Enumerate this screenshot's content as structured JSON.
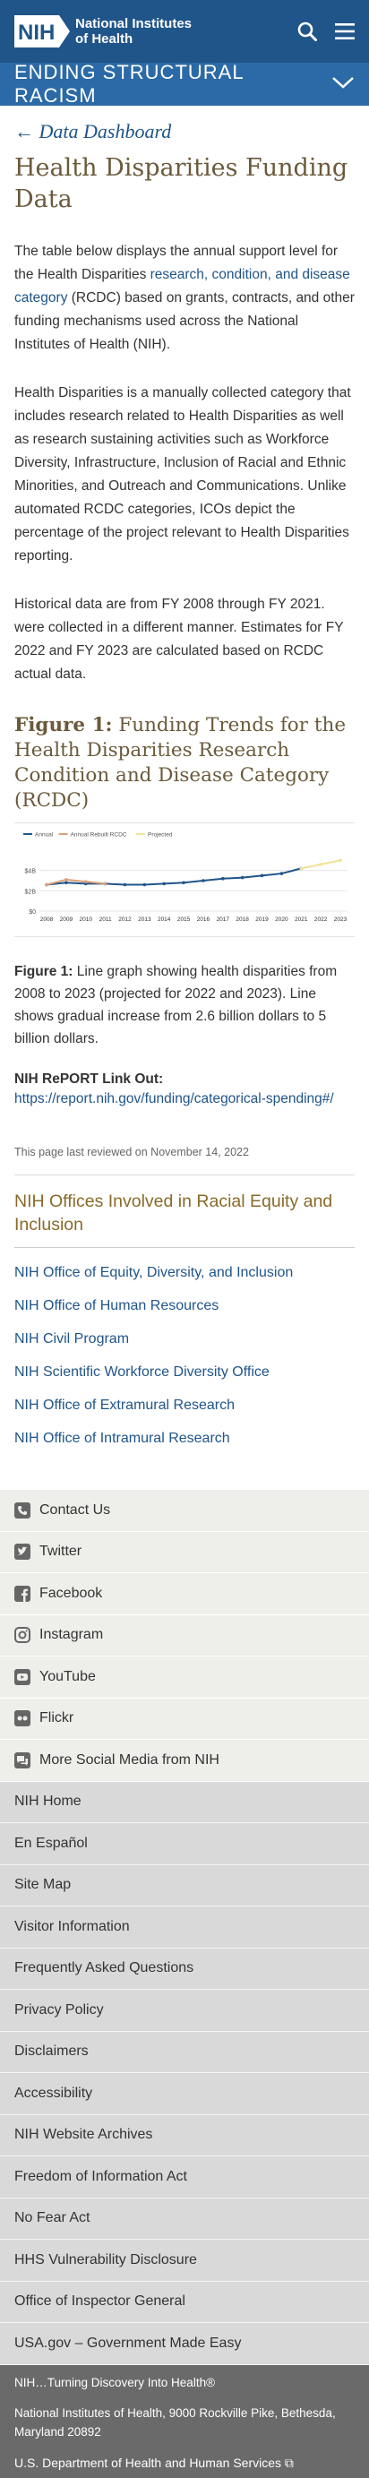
{
  "header": {
    "logo_badge": "NIH",
    "logo_line1": "National Institutes",
    "logo_line2": "of Health"
  },
  "banner": {
    "title": "ENDING STRUCTURAL RACISM"
  },
  "main": {
    "back_link": "← Data Dashboard",
    "title": "Health Disparities Funding Data",
    "p1_pre": "The table below displays the annual support level for the Health Disparities ",
    "p1_link": "research, condition, and disease category",
    "p1_post": " (RCDC) based on grants, contracts, and other funding mechanisms used across the National Institutes of Health (NIH).",
    "p2": "Health Disparities is a manually collected category that includes research related to Health Disparities as well as research sustaining activities such as Workforce Diversity, Infrastructure, Inclusion of Racial and Ethnic Minorities, and Outreach and Communications. Unlike automated RCDC categories, ICOs depict the percentage of the project relevant to Health Disparities reporting.",
    "p3": "Historical data are from FY 2008 through FY 2021. were collected in a different manner. Estimates for FY 2022 and FY 2023 are calculated based on RCDC actual data.",
    "figure_label": "Figure 1:",
    "figure_title": " Funding Trends for the Health Disparities Research Condition and Disease Category (RCDC)",
    "caption_label": "Figure 1:",
    "caption_text": " Line graph showing health disparities from 2008 to 2023 (projected for 2022 and 2023). Line shows gradual increase from 2.6 billion dollars to 5 billion dollars.",
    "report_label": "NIH RePORT Link Out:",
    "report_url": "https://report.nih.gov/funding/categorical-spending#/",
    "reviewed": "This page last reviewed on November 14, 2022",
    "offices_title": "NIH Offices Involved in Racial Equity and Inclusion",
    "offices": [
      "NIH Office of Equity, Diversity, and Inclusion",
      "NIH Office of Human Resources",
      "NIH Civil Program",
      "NIH Scientific Workforce Diversity Office",
      "NIH Office of Extramural Research",
      "NIH Office of Intramural Research"
    ]
  },
  "chart_data": {
    "type": "line",
    "legend": [
      "Annual",
      "Annual Rebuilt RCDC",
      "Projected"
    ],
    "legend_placement": "top-left",
    "x": [
      "2008",
      "2009",
      "2010",
      "2011",
      "2012",
      "2013",
      "2014",
      "2015",
      "2016",
      "2017",
      "2018",
      "2019",
      "2020",
      "2021",
      "2022",
      "2023"
    ],
    "yticks": [
      "$0",
      "$2B",
      "$4B"
    ],
    "ylim": [
      0,
      6
    ],
    "series": [
      {
        "name": "Annual",
        "color": "#20558a",
        "values": [
          2.6,
          2.8,
          2.7,
          2.7,
          2.6,
          2.6,
          2.7,
          2.8,
          3.0,
          3.2,
          3.3,
          3.5,
          3.7,
          4.2,
          null,
          null
        ]
      },
      {
        "name": "Annual Rebuilt RCDC",
        "color": "#d9a07a",
        "values": [
          2.6,
          3.1,
          2.9,
          2.7,
          null,
          null,
          null,
          null,
          null,
          null,
          null,
          null,
          null,
          null,
          null,
          null
        ]
      },
      {
        "name": "Projected",
        "color": "#f2e29a",
        "values": [
          null,
          null,
          null,
          null,
          null,
          null,
          null,
          null,
          null,
          null,
          null,
          null,
          null,
          4.2,
          4.6,
          5.0
        ]
      }
    ]
  },
  "footer": {
    "social": [
      {
        "label": "Contact Us",
        "icon": "phone-icon"
      },
      {
        "label": "Twitter",
        "icon": "twitter-icon"
      },
      {
        "label": "Facebook",
        "icon": "facebook-icon"
      },
      {
        "label": "Instagram",
        "icon": "instagram-icon"
      },
      {
        "label": "YouTube",
        "icon": "youtube-icon"
      },
      {
        "label": "Flickr",
        "icon": "flickr-icon"
      },
      {
        "label": "More Social Media from NIH",
        "icon": "chat-icon"
      }
    ],
    "links": [
      "NIH Home",
      "En Español",
      "Site Map",
      "Visitor Information",
      "Frequently Asked Questions",
      "Privacy Policy",
      "Disclaimers",
      "Accessibility",
      "NIH Website Archives",
      "Freedom of Information Act",
      "No Fear Act",
      "HHS Vulnerability Disclosure",
      "Office of Inspector General",
      "USA.gov – Government Made Easy"
    ],
    "tagline": "NIH…Turning Discovery Into Health®",
    "address": "National Institutes of Health, 9000 Rockville Pike, Bethesda, Maryland 20892",
    "hhs": "U.S. Department of Health and Human Services"
  }
}
